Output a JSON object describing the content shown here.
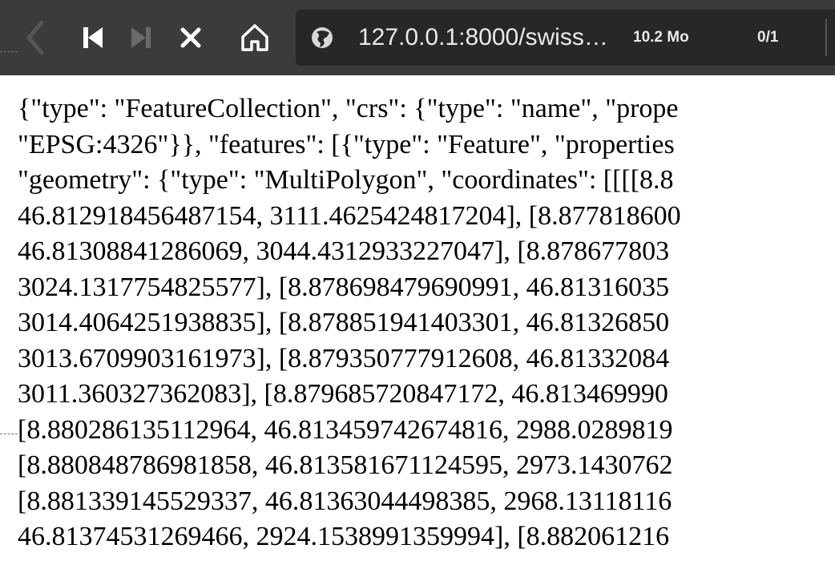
{
  "toolbar": {
    "icons": {
      "back": "chevron-left-icon",
      "first": "skip-back-icon",
      "last": "skip-forward-icon",
      "stop": "close-icon",
      "home": "home-icon",
      "site": "globe-icon"
    },
    "url": "127.0.0.1:8000/swiss…",
    "file_size": "10.2 Mo",
    "page_count": "0/1"
  },
  "content": {
    "lines": [
      "{\"type\": \"FeatureCollection\", \"crs\": {\"type\": \"name\", \"prope",
      "\"EPSG:4326\"}}, \"features\": [{\"type\": \"Feature\", \"properties",
      "\"geometry\": {\"type\": \"MultiPolygon\", \"coordinates\": [[[[8.8",
      "46.812918456487154, 3111.4625424817204], [8.877818600",
      "46.81308841286069, 3044.4312933227047], [8.878677803",
      "3024.1317754825577], [8.878698479690991, 46.81316035",
      "3014.4064251938835], [8.878851941403301, 46.81326850",
      "3013.6709903161973], [8.879350777912608, 46.81332084",
      "3011.360327362083], [8.879685720847172, 46.813469990",
      "[8.880286135112964, 46.813459742674816, 2988.0289819",
      "[8.880848786981858, 46.813581671124595, 2973.1430762",
      "[8.881339145529337, 46.81363044498385, 2968.13118116",
      "46.81374531269466, 2924.1538991359994], [8.882061216"
    ]
  },
  "colors": {
    "toolbar_bg": "#3b3b3b",
    "urlbar_bg": "#272727",
    "toolbar_text": "#e9e9e9",
    "disabled_icon": "#6a6a6a"
  }
}
